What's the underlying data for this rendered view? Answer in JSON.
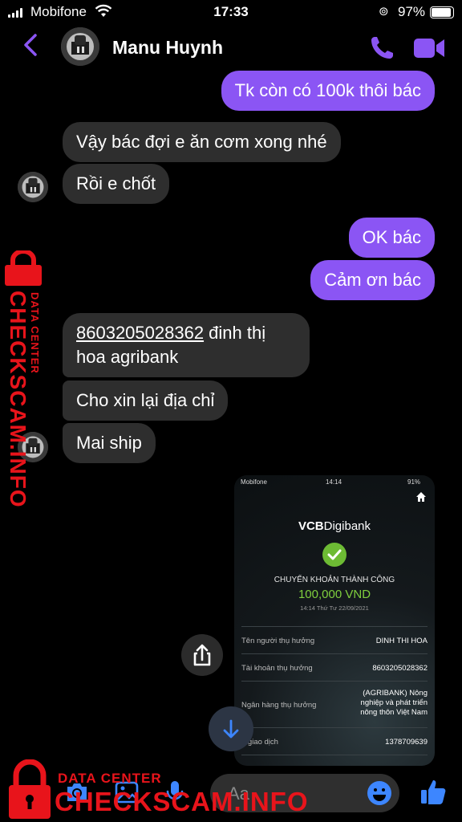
{
  "status_bar": {
    "carrier": "Mobifone",
    "time": "17:33",
    "battery": "97%"
  },
  "header": {
    "contact_name": "Manu Huynh"
  },
  "messages": [
    {
      "direction": "out",
      "text": "Tk còn có 100k thôi bác"
    },
    {
      "direction": "in",
      "text": "Vậy bác đợi e ăn cơm xong nhé"
    },
    {
      "direction": "in",
      "text": "Rồi e chốt"
    },
    {
      "direction": "out",
      "text": "OK bác"
    },
    {
      "direction": "out",
      "text": "Cảm ơn bác"
    },
    {
      "direction": "in",
      "account": "8603205028362",
      "text": " đinh thị",
      "line2": "hoa agribank"
    },
    {
      "direction": "in",
      "text": "Cho xin lại địa chỉ"
    },
    {
      "direction": "in",
      "text": "Mai ship"
    }
  ],
  "receipt": {
    "status_carrier": "Mobifone",
    "status_time": "14:14",
    "status_battery": "91%",
    "brand_a": "VCB",
    "brand_b": "Digibank",
    "success": "CHUYỂN KHOẢN THÀNH CÔNG",
    "amount": "100,000 VND",
    "datetime": "14:14 Thứ Tư 22/09/2021",
    "rows": [
      {
        "label": "Tên người thụ hưởng",
        "value": "DINH THI HOA"
      },
      {
        "label": "Tài khoản thụ hưởng",
        "value": "8603205028362"
      },
      {
        "label": "Ngân hàng thụ hưởng",
        "value_lines": [
          "(AGRIBANK) Nông",
          "nghiệp và phát triển",
          "nông thôn Việt Nam"
        ]
      },
      {
        "label": "Mã giao dịch",
        "label_visible": "ã giao dịch",
        "value": "1378709639"
      }
    ]
  },
  "composer": {
    "placeholder": "Aa"
  },
  "watermark": {
    "line1": "DATA CENTER",
    "line2": "CHECKSCAM.INFO",
    "color": "#e8141b"
  },
  "colors": {
    "accent": "#8b55f4",
    "incoming_bubble": "#2e2e2e",
    "background": "#000000",
    "success_green": "#7fcf3e"
  },
  "icons": {
    "back": "chevron-left-icon",
    "call": "phone-icon",
    "video": "video-camera-icon",
    "share": "share-icon",
    "scroll_down": "arrow-down-icon",
    "camera": "camera-icon",
    "photo": "photo-icon",
    "mic": "microphone-icon",
    "emoji": "emoji-icon",
    "like": "thumbs-up-icon"
  }
}
